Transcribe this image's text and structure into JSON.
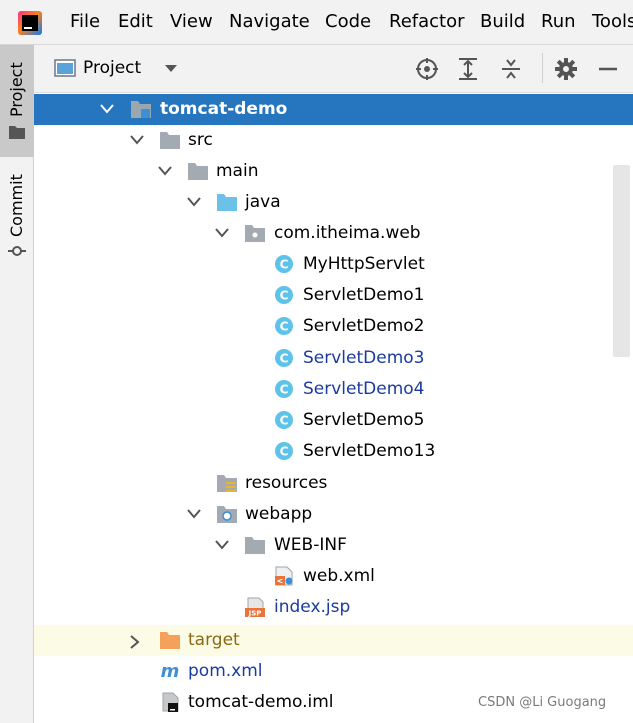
{
  "menu": {
    "items": [
      {
        "label": "File"
      },
      {
        "label": "Edit"
      },
      {
        "label": "View"
      },
      {
        "label": "Navigate"
      },
      {
        "label": "Code"
      },
      {
        "label": "Refactor"
      },
      {
        "label": "Build"
      },
      {
        "label": "Run"
      },
      {
        "label": "Tools"
      }
    ]
  },
  "side_tabs": {
    "project": "Project",
    "commit": "Commit"
  },
  "project_panel": {
    "title": "Project",
    "icons": [
      "locate-icon",
      "expand-all-icon",
      "collapse-all-icon",
      "gear-icon",
      "minimize-icon"
    ]
  },
  "tree": [
    {
      "label": "tomcat-demo",
      "icon": "module-folder-icon",
      "expanded": true,
      "selected": true
    },
    {
      "label": "src",
      "icon": "folder-icon",
      "expanded": true
    },
    {
      "label": "main",
      "icon": "folder-icon",
      "expanded": true
    },
    {
      "label": "java",
      "icon": "source-folder-icon",
      "expanded": true
    },
    {
      "label": "com.itheima.web",
      "icon": "package-icon",
      "expanded": true
    },
    {
      "label": "MyHttpServlet",
      "icon": "class-icon"
    },
    {
      "label": "ServletDemo1",
      "icon": "class-icon"
    },
    {
      "label": "ServletDemo2",
      "icon": "class-icon"
    },
    {
      "label": "ServletDemo3",
      "icon": "class-icon",
      "color": "#1a3b9f"
    },
    {
      "label": "ServletDemo4",
      "icon": "class-icon",
      "color": "#1a3b9f"
    },
    {
      "label": "ServletDemo5",
      "icon": "class-icon"
    },
    {
      "label": "ServletDemo13",
      "icon": "class-icon"
    },
    {
      "label": "resources",
      "icon": "resources-folder-icon"
    },
    {
      "label": "webapp",
      "icon": "web-folder-icon",
      "expanded": true
    },
    {
      "label": "WEB-INF",
      "icon": "folder-icon",
      "expanded": true
    },
    {
      "label": "web.xml",
      "icon": "xml-file-icon"
    },
    {
      "label": "index.jsp",
      "icon": "jsp-file-icon",
      "color": "#1a3b9f"
    },
    {
      "label": "target",
      "icon": "excluded-folder-icon",
      "expanded": false,
      "color": "#8a6a12"
    },
    {
      "label": "pom.xml",
      "icon": "maven-icon",
      "color": "#1a3b9f"
    },
    {
      "label": "tomcat-demo.iml",
      "icon": "iml-file-icon"
    }
  ],
  "watermark": "CSDN @Li Guogang",
  "colors": {
    "selection": "#2675bf",
    "vcs_new": "#1a3b9f",
    "excluded": "#8a6a12",
    "folder": "#a3aab2",
    "source_folder": "#6cc1e8",
    "class_icon": "#5ec3e8"
  }
}
